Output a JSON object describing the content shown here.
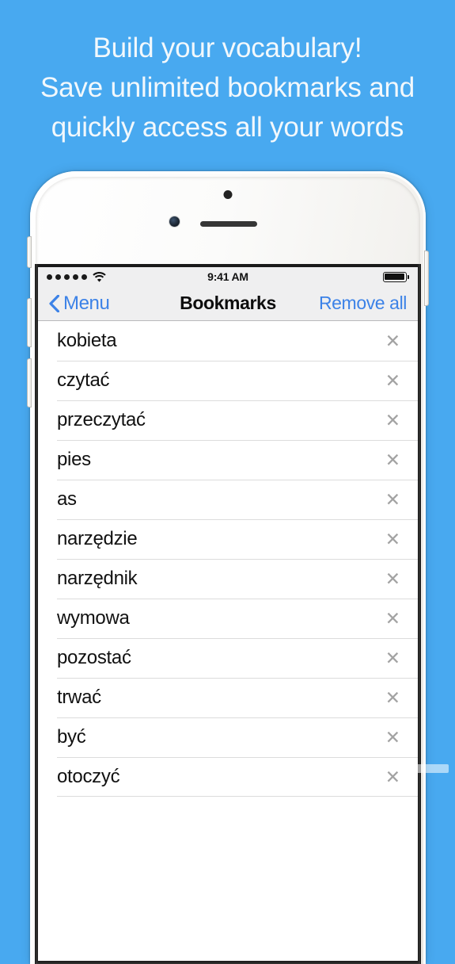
{
  "promo": {
    "lines": [
      "Build your vocabulary!",
      "Save unlimited bookmarks and",
      "quickly access all your words"
    ]
  },
  "colors": {
    "background_blue": "#48A9F0",
    "promo_text": "#F2F8FC",
    "ios_tint_blue": "#3C82E7",
    "nav_bar_gray": "#EFEFF0",
    "separator_gray": "#DCDCDC",
    "delete_icon_gray": "#A3A3A3",
    "title_black": "#0D0D0D"
  },
  "device": {
    "icons": {
      "sensor": "proximity-sensor",
      "camera": "front-camera",
      "speaker": "earpiece-speaker",
      "silent_switch": "silent-switch",
      "volume_up": "volume-up-button",
      "volume_down": "volume-down-button",
      "power": "power-button"
    }
  },
  "status_bar": {
    "signal_dots": 5,
    "signal_dots_filled": 5,
    "wifi_icon": "wifi-icon",
    "time": "9:41 AM",
    "battery_icon": "battery-full-icon",
    "battery_level_percent": 100
  },
  "nav_bar": {
    "back_chevron_icon": "chevron-left-icon",
    "back_label": "Menu",
    "title": "Bookmarks",
    "right_action_label": "Remove all"
  },
  "bookmarks": {
    "delete_icon": "close-x-icon",
    "items": [
      {
        "word": "kobieta"
      },
      {
        "word": "czytać"
      },
      {
        "word": "przeczytać"
      },
      {
        "word": "pies"
      },
      {
        "word": "as"
      },
      {
        "word": "narzędzie"
      },
      {
        "word": "narzędnik"
      },
      {
        "word": "wymowa"
      },
      {
        "word": "pozostać"
      },
      {
        "word": "trwać"
      },
      {
        "word": "być"
      },
      {
        "word": "otoczyć"
      }
    ]
  }
}
